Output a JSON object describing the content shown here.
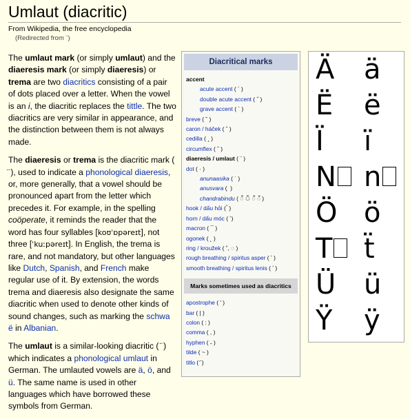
{
  "title": "Umlaut (diacritic)",
  "subtitle": "From Wikipedia, the free encyclopedia",
  "redirect": "(Redirected from ¨)",
  "p1": {
    "t1": "The ",
    "b1": "umlaut mark",
    "t2": " (or simply ",
    "b2": "umlaut",
    "t3": ") and the ",
    "b3": "diaeresis mark",
    "t4": " (or simply ",
    "b4": "diaeresis",
    "t5": ") or ",
    "b5": "trema",
    "t6": " are two ",
    "l1": "diacritics",
    "t7": " consisting of a pair of dots placed over a letter. When the vowel is an ",
    "i1": "i",
    "t8": ", the diacritic replaces the ",
    "l2": "tittle",
    "t9": ". The two diacritics are very similar in appearance, and the distinction between them is not always made."
  },
  "p2": {
    "t1": "The ",
    "b1": "diaeresis",
    "t2": " or ",
    "b2": "trema",
    "t3": " is the diacritic mark ( ̈ ), used to indicate a ",
    "l1": "phonological diaeresis",
    "t4": ", or, more generally, that a vowel should be pronounced apart from the letter which precedes it. For example, in the spelling ",
    "i1": "coöperate",
    "t5": ", it reminds the reader that the word has four syllables [",
    "ipa1": "koʊˈɒpəreɪt",
    "t6": "], not three [",
    "ipa2": "ˈkuːpəreɪt",
    "t7": "]. In English, the trema is rare, and not mandatory, but other languages like ",
    "l2": "Dutch",
    "t8": ", ",
    "l3": "Spanish",
    "t9": ", and ",
    "l4": "French",
    "t10": " make regular use of it. By extension, the words trema and diaeresis also designate the same diacritic when used to denote other kinds of sound changes, such as marking the ",
    "l5": "schwa ë",
    "t11": " in ",
    "l6": "Albanian",
    "t12": "."
  },
  "p3": {
    "t1": "The ",
    "b1": "umlaut",
    "t2": " is a similar-looking diacritic ( ̈ ) which indicates a ",
    "l1": "phonological umlaut",
    "t3": " in German. The umlauted vowels are ",
    "l2": "ä",
    "t4": ", ",
    "l3": "ö",
    "t5": ", and ",
    "l4": "ü",
    "t6": ". The same name is used in other languages which have borrowed these symbols from German."
  },
  "infobox": {
    "title": "Diacritical marks",
    "accent": "acute",
    "items": [
      {
        "label": "accent",
        "sub": "",
        "indent": false,
        "dark": true,
        "italic": false,
        "key": "accent"
      },
      {
        "label": "acute accent",
        "sub": " ( ´ )",
        "indent": true
      },
      {
        "label": "double acute accent",
        "sub": " ( ˝ )",
        "indent": true
      },
      {
        "label": "grave accent",
        "sub": " ( ˋ )",
        "indent": true
      },
      {
        "label": "breve",
        "sub": " ( ˘ )"
      },
      {
        "label": "caron / háček",
        "sub": " ( ˇ )"
      },
      {
        "label": "cedilla",
        "sub": " ( ¸ )"
      },
      {
        "label": "circumflex",
        "sub": " ( ˆ )"
      },
      {
        "label": "diaeresis / umlaut",
        "sub": " ( ¨ )",
        "dark": true
      },
      {
        "label": "dot",
        "sub": " ( · )"
      },
      {
        "label": "anunaasika",
        "sub": " ( ˙ )",
        "indent": true,
        "italic": true
      },
      {
        "label": "anusvara",
        "sub": " ( ̣ )",
        "indent": true,
        "italic": true
      },
      {
        "label": "chandrabindu",
        "sub": " (  ँ  ঁ  ँ  ◌ँ )",
        "indent": true,
        "italic": true
      },
      {
        "label": "hook / dấu hỏi",
        "sub": " ( ̉ )"
      },
      {
        "label": "horn / dấu móc",
        "sub": " ( ̛ )"
      },
      {
        "label": "macron",
        "sub": " ( ¯ )"
      },
      {
        "label": "ogonek",
        "sub": " ( ˛ )"
      },
      {
        "label": "ring / kroužek",
        "sub": " ( ˚, ◌ )"
      },
      {
        "label": "rough breathing / spiritus asper",
        "sub": " ( ʽ )"
      },
      {
        "label": "smooth breathing / spiritus lenis",
        "sub": " ( ʼ )"
      }
    ],
    "section2": "Marks sometimes used as diacritics",
    "items2": [
      {
        "label": "apostrophe",
        "sub": " ( ' )"
      },
      {
        "label": "bar",
        "sub": " ( | )"
      },
      {
        "label": "colon",
        "sub": " ( : )"
      },
      {
        "label": "comma",
        "sub": " ( , )"
      },
      {
        "label": "hyphen",
        "sub": " ( ˗ )"
      },
      {
        "label": "tilde",
        "sub": " ( ~ )"
      },
      {
        "label": "titlo",
        "sub": " ( ҃ )"
      }
    ]
  },
  "letters": [
    {
      "upper": "Ä",
      "lower": "ä"
    },
    {
      "upper": "Ë",
      "lower": "ë"
    },
    {
      "upper": "Ï",
      "lower": "ï"
    },
    {
      "upper": "N",
      "lower": "n",
      "upper_box": true,
      "lower_box": true
    },
    {
      "upper": "Ö",
      "lower": "ö"
    },
    {
      "upper": "T",
      "lower": "ẗ",
      "upper_box": true
    },
    {
      "upper": "Ü",
      "lower": "ü"
    },
    {
      "upper": "Ÿ",
      "lower": "ÿ"
    }
  ]
}
